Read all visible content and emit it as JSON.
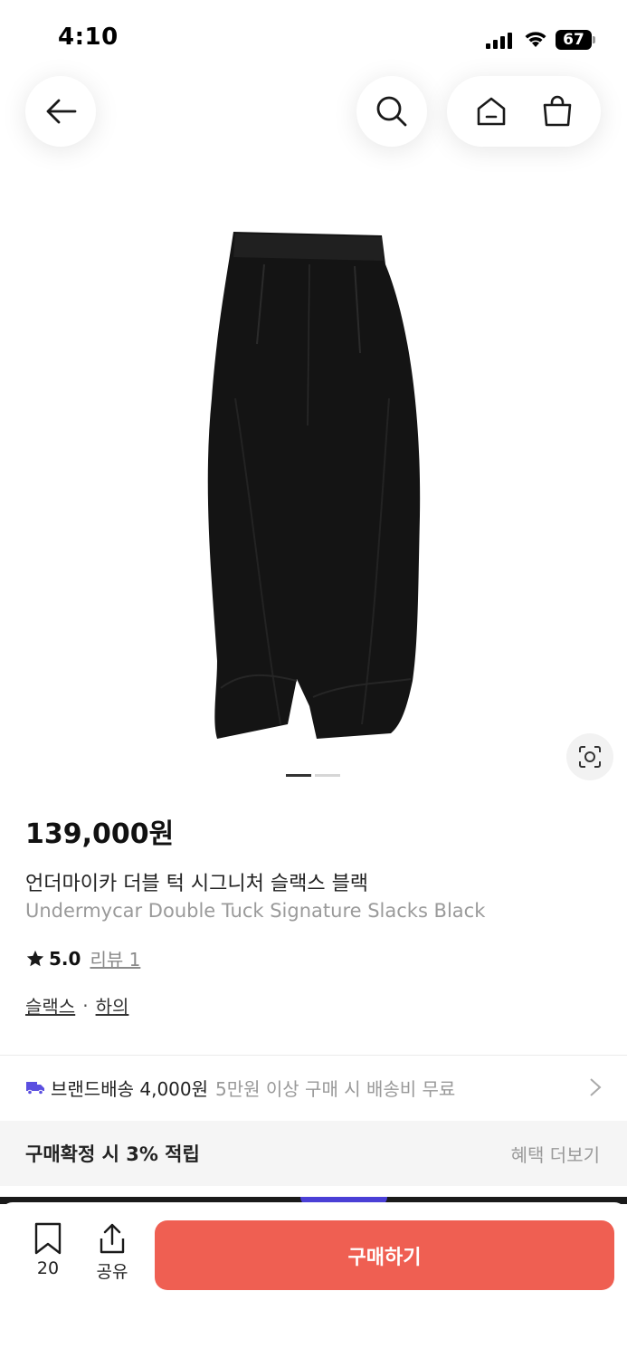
{
  "status_bar": {
    "time": "4:10",
    "battery": "67"
  },
  "nav": {
    "back_icon": "arrow-left-icon",
    "search_icon": "search-icon",
    "home_icon": "home-icon",
    "cart_icon": "shopping-bag-icon"
  },
  "product": {
    "price": "139,000원",
    "title_ko": "언더마이카 더블 턱 시그니처 슬랙스 블랙",
    "title_en": "Undermycar Double Tuck Signature Slacks Black",
    "rating": "5.0",
    "review_label": "리뷰 1",
    "categories": [
      "슬랙스",
      "하의"
    ],
    "category_separator": "·",
    "image_pager": {
      "total": 2,
      "current": 1
    }
  },
  "shipping": {
    "label": "브랜드배송 4,000원",
    "note": "5만원 이상 구매 시 배송비 무료"
  },
  "points": {
    "label": "구매확정 시 3% 적립",
    "more": "혜택 더보기"
  },
  "bottom_bar": {
    "bookmark_count": "20",
    "share_label": "공유",
    "buy_label": "구매하기"
  },
  "colors": {
    "accent": "#ef5f52",
    "truck": "#5b4fe0",
    "text_muted": "#9a9a9a"
  }
}
